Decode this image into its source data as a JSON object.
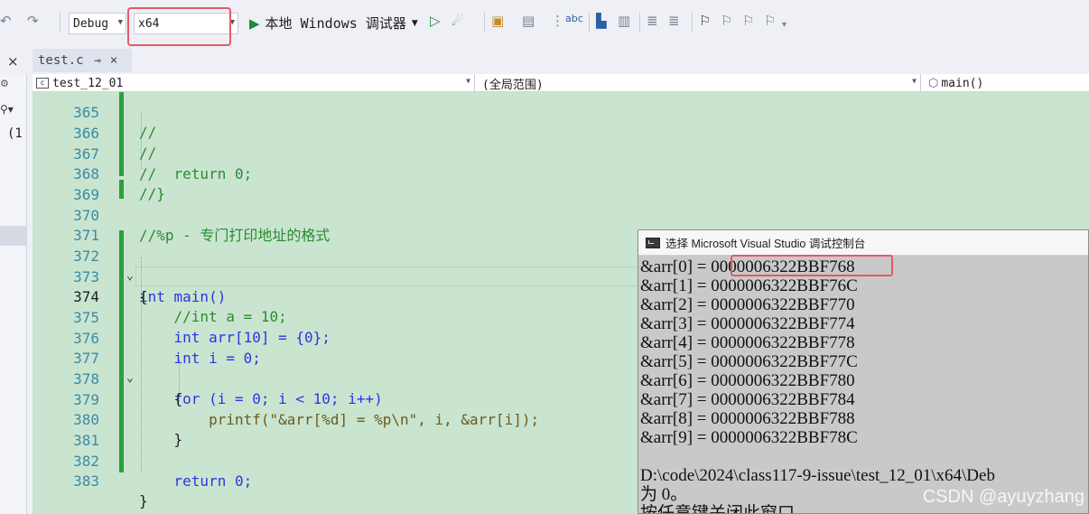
{
  "toolbar": {
    "config": "Debug",
    "platform": "x64",
    "run_label": "本地 Windows 调试器",
    "run_icon": "play-icon"
  },
  "tabs": [
    {
      "label": "test.c"
    }
  ],
  "navbar": {
    "project": "test_12_01",
    "scope": "(全局范围)",
    "member": "main()"
  },
  "left_strip": {
    "close": "×",
    "paren": "(1"
  },
  "editor": {
    "current_line": "374",
    "lines": [
      {
        "n": "365",
        "code": "//"
      },
      {
        "n": "366",
        "code": "//"
      },
      {
        "n": "367",
        "code": "//  return 0;"
      },
      {
        "n": "368",
        "code": "//}"
      },
      {
        "n": "369",
        "code": ""
      },
      {
        "n": "370",
        "code": "//%p - 专门打印地址的格式"
      },
      {
        "n": "371",
        "code": ""
      },
      {
        "n": "372",
        "code": "int main()"
      },
      {
        "n": "373",
        "code": "{"
      },
      {
        "n": "374",
        "code": "    //int a = 10;"
      },
      {
        "n": "375",
        "code": "    int arr[10] = {0};"
      },
      {
        "n": "376",
        "code": "    int i = 0;"
      },
      {
        "n": "377",
        "code": "    for (i = 0; i < 10; i++)"
      },
      {
        "n": "378",
        "code": "    {"
      },
      {
        "n": "379",
        "code": "        printf(\"&arr[%d] = %p\\n\", i, &arr[i]);"
      },
      {
        "n": "380",
        "code": "    }"
      },
      {
        "n": "381",
        "code": ""
      },
      {
        "n": "382",
        "code": "    return 0;"
      },
      {
        "n": "383",
        "code": "}"
      }
    ]
  },
  "console": {
    "title": "选择 Microsoft Visual Studio 调试控制台",
    "lines": [
      "&arr[0] = 0000006322BBF768",
      "&arr[1] = 0000006322BBF76C",
      "&arr[2] = 0000006322BBF770",
      "&arr[3] = 0000006322BBF774",
      "&arr[4] = 0000006322BBF778",
      "&arr[5] = 0000006322BBF77C",
      "&arr[6] = 0000006322BBF780",
      "&arr[7] = 0000006322BBF784",
      "&arr[8] = 0000006322BBF788",
      "&arr[9] = 0000006322BBF78C"
    ],
    "path_line": "D:\\code\\2024\\class117-9-issue\\test_12_01\\x64\\Deb",
    "exit_line": "为 0。",
    "close_hint": "按任意键关闭此窗口",
    "watermark": "CSDN @ayuyzhang"
  },
  "colors": {
    "editor_bg": "#c9e5cf",
    "gutter_bar": "#2e9f3a",
    "highlight_box": "#e35a6a"
  }
}
